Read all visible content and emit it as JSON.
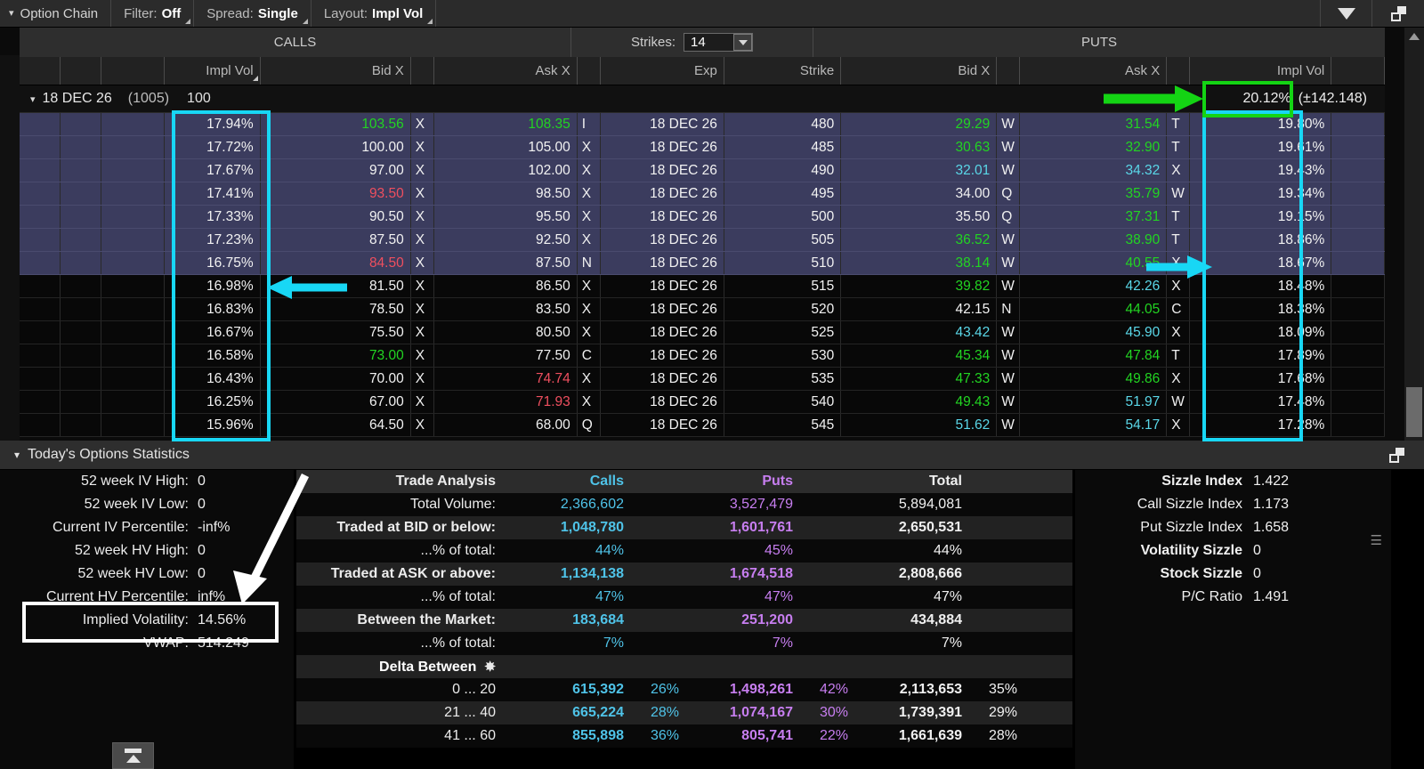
{
  "topbar": {
    "title": "Option Chain",
    "filter_label": "Filter:",
    "filter_value": "Off",
    "spread_label": "Spread:",
    "spread_value": "Single",
    "layout_label": "Layout:",
    "layout_value": "Impl Vol",
    "dropdown_icon": "triangle-down-icon",
    "popout_icon": "popout-window-icon"
  },
  "chain": {
    "calls_header": "CALLS",
    "puts_header": "PUTS",
    "strikes_label": "Strikes:",
    "strikes_value": "14",
    "columns": {
      "call_impl_vol": "Impl Vol",
      "call_bid": "Bid X",
      "call_ask": "Ask X",
      "exp": "Exp",
      "strike": "Strike",
      "put_bid": "Bid X",
      "put_ask": "Ask X",
      "put_impl_vol": "Impl Vol"
    },
    "expiry": {
      "name": "18 DEC 26",
      "days": "(1005)",
      "multiplier": "100",
      "header_iv": "20.12%",
      "header_iv_range": "(±142.148)"
    },
    "rows": [
      {
        "civ": "17.94%",
        "cbid": "103.56",
        "cbx": "X",
        "cask": "108.35",
        "cax": "I",
        "exp": "18 DEC 26",
        "strike": "480",
        "pbid": "29.29",
        "pbx": "W",
        "pask": "31.54",
        "pax": "T",
        "piv": "19.80%",
        "sel": true,
        "cbid_c": "green",
        "cbx_c": "green",
        "cask_c": "green",
        "cax_c": "green",
        "pbid_c": "green",
        "pbx_c": "green",
        "pask_c": "green",
        "pax_c": "green"
      },
      {
        "civ": "17.72%",
        "cbid": "100.00",
        "cbx": "X",
        "cask": "105.00",
        "cax": "X",
        "exp": "18 DEC 26",
        "strike": "485",
        "pbid": "30.63",
        "pbx": "W",
        "pask": "32.90",
        "pax": "T",
        "piv": "19.61%",
        "sel": true,
        "cbid_c": "white",
        "cbx_c": "white",
        "cask_c": "white",
        "cax_c": "white",
        "pbid_c": "green",
        "pbx_c": "green",
        "pask_c": "green",
        "pax_c": "green"
      },
      {
        "civ": "17.67%",
        "cbid": "97.00",
        "cbx": "X",
        "cask": "102.00",
        "cax": "X",
        "exp": "18 DEC 26",
        "strike": "490",
        "pbid": "32.01",
        "pbx": "W",
        "pask": "34.32",
        "pax": "X",
        "piv": "19.43%",
        "sel": true,
        "cbid_c": "white",
        "cbx_c": "white",
        "cask_c": "white",
        "cax_c": "white",
        "pbid_c": "cyan",
        "pbx_c": "cyan",
        "pask_c": "cyan",
        "pax_c": "cyan"
      },
      {
        "civ": "17.41%",
        "cbid": "93.50",
        "cbx": "X",
        "cask": "98.50",
        "cax": "X",
        "exp": "18 DEC 26",
        "strike": "495",
        "pbid": "34.00",
        "pbx": "Q",
        "pask": "35.79",
        "pax": "W",
        "piv": "19.34%",
        "sel": true,
        "cbid_c": "red",
        "cbx_c": "red",
        "cask_c": "white",
        "cax_c": "white",
        "pbid_c": "white",
        "pbx_c": "white",
        "pask_c": "green",
        "pax_c": "green"
      },
      {
        "civ": "17.33%",
        "cbid": "90.50",
        "cbx": "X",
        "cask": "95.50",
        "cax": "X",
        "exp": "18 DEC 26",
        "strike": "500",
        "pbid": "35.50",
        "pbx": "Q",
        "pask": "37.31",
        "pax": "T",
        "piv": "19.15%",
        "sel": true,
        "cbid_c": "white",
        "cbx_c": "white",
        "cask_c": "white",
        "cax_c": "white",
        "pbid_c": "white",
        "pbx_c": "white",
        "pask_c": "green",
        "pax_c": "green"
      },
      {
        "civ": "17.23%",
        "cbid": "87.50",
        "cbx": "X",
        "cask": "92.50",
        "cax": "X",
        "exp": "18 DEC 26",
        "strike": "505",
        "pbid": "36.52",
        "pbx": "W",
        "pask": "38.90",
        "pax": "T",
        "piv": "18.86%",
        "sel": true,
        "cbid_c": "white",
        "cbx_c": "white",
        "cask_c": "white",
        "cax_c": "white",
        "pbid_c": "green",
        "pbx_c": "green",
        "pask_c": "green",
        "pax_c": "green"
      },
      {
        "civ": "16.75%",
        "cbid": "84.50",
        "cbx": "X",
        "cask": "87.50",
        "cax": "N",
        "exp": "18 DEC 26",
        "strike": "510",
        "pbid": "38.14",
        "pbx": "W",
        "pask": "40.55",
        "pax": "X",
        "piv": "18.67%",
        "sel": true,
        "cbid_c": "red",
        "cbx_c": "red",
        "cask_c": "white",
        "cax_c": "white",
        "pbid_c": "green",
        "pbx_c": "green",
        "pask_c": "green",
        "pax_c": "green"
      },
      {
        "civ": "16.98%",
        "cbid": "81.50",
        "cbx": "X",
        "cask": "86.50",
        "cax": "X",
        "exp": "18 DEC 26",
        "strike": "515",
        "pbid": "39.82",
        "pbx": "W",
        "pask": "42.26",
        "pax": "X",
        "piv": "18.48%",
        "sel": false,
        "cbid_c": "white",
        "cbx_c": "white",
        "cask_c": "white",
        "cax_c": "white",
        "pbid_c": "green",
        "pbx_c": "green",
        "pask_c": "cyan",
        "pax_c": "cyan"
      },
      {
        "civ": "16.83%",
        "cbid": "78.50",
        "cbx": "X",
        "cask": "83.50",
        "cax": "X",
        "exp": "18 DEC 26",
        "strike": "520",
        "pbid": "42.15",
        "pbx": "N",
        "pask": "44.05",
        "pax": "C",
        "piv": "18.38%",
        "sel": false,
        "cbid_c": "white",
        "cbx_c": "white",
        "cask_c": "white",
        "cax_c": "white",
        "pbid_c": "white",
        "pbx_c": "white",
        "pask_c": "green",
        "pax_c": "green"
      },
      {
        "civ": "16.67%",
        "cbid": "75.50",
        "cbx": "X",
        "cask": "80.50",
        "cax": "X",
        "exp": "18 DEC 26",
        "strike": "525",
        "pbid": "43.42",
        "pbx": "W",
        "pask": "45.90",
        "pax": "X",
        "piv": "18.09%",
        "sel": false,
        "cbid_c": "white",
        "cbx_c": "white",
        "cask_c": "white",
        "cax_c": "white",
        "pbid_c": "cyan",
        "pbx_c": "cyan",
        "pask_c": "cyan",
        "pax_c": "cyan"
      },
      {
        "civ": "16.58%",
        "cbid": "73.00",
        "cbx": "X",
        "cask": "77.50",
        "cax": "C",
        "exp": "18 DEC 26",
        "strike": "530",
        "pbid": "45.34",
        "pbx": "W",
        "pask": "47.84",
        "pax": "T",
        "piv": "17.89%",
        "sel": false,
        "cbid_c": "green",
        "cbx_c": "green",
        "cask_c": "white",
        "cax_c": "white",
        "pbid_c": "green",
        "pbx_c": "green",
        "pask_c": "green",
        "pax_c": "green"
      },
      {
        "civ": "16.43%",
        "cbid": "70.00",
        "cbx": "X",
        "cask": "74.74",
        "cax": "X",
        "exp": "18 DEC 26",
        "strike": "535",
        "pbid": "47.33",
        "pbx": "W",
        "pask": "49.86",
        "pax": "X",
        "piv": "17.68%",
        "sel": false,
        "cbid_c": "white",
        "cbx_c": "white",
        "cask_c": "red",
        "cax_c": "red",
        "pbid_c": "green",
        "pbx_c": "green",
        "pask_c": "green",
        "pax_c": "green"
      },
      {
        "civ": "16.25%",
        "cbid": "67.00",
        "cbx": "X",
        "cask": "71.93",
        "cax": "X",
        "exp": "18 DEC 26",
        "strike": "540",
        "pbid": "49.43",
        "pbx": "W",
        "pask": "51.97",
        "pax": "W",
        "piv": "17.48%",
        "sel": false,
        "cbid_c": "white",
        "cbx_c": "white",
        "cask_c": "red",
        "cax_c": "red",
        "pbid_c": "green",
        "pbx_c": "green",
        "pask_c": "cyan",
        "pax_c": "cyan"
      },
      {
        "civ": "15.96%",
        "cbid": "64.50",
        "cbx": "X",
        "cask": "68.00",
        "cax": "Q",
        "exp": "18 DEC 26",
        "strike": "545",
        "pbid": "51.62",
        "pbx": "W",
        "pask": "54.17",
        "pax": "X",
        "piv": "17.28%",
        "sel": false,
        "cbid_c": "white",
        "cbx_c": "white",
        "cask_c": "white",
        "cax_c": "white",
        "pbid_c": "cyan",
        "pbx_c": "cyan",
        "pask_c": "cyan",
        "pax_c": "cyan"
      }
    ]
  },
  "stats": {
    "title": "Today's Options Statistics",
    "left_rows": [
      {
        "label": "52 week IV High:",
        "value": "0"
      },
      {
        "label": "52 week IV Low:",
        "value": "0"
      },
      {
        "label": "Current IV Percentile:",
        "value": "-inf%"
      },
      {
        "label": "52 week HV High:",
        "value": "0"
      },
      {
        "label": "52 week HV Low:",
        "value": "0"
      },
      {
        "label": "Current HV Percentile:",
        "value": "inf%"
      },
      {
        "label": "Implied Volatility:",
        "value": "14.56%"
      },
      {
        "label": "VWAP:",
        "value": "514.249"
      }
    ],
    "trade_analysis": {
      "title": "Trade Analysis",
      "col_calls": "Calls",
      "col_puts": "Puts",
      "col_total": "Total",
      "rows": [
        {
          "label": "Total Volume:",
          "bold": false,
          "calls": "2,366,602",
          "puts": "3,527,479",
          "total": "5,894,081"
        },
        {
          "label": "Traded at BID or below:",
          "bold": true,
          "calls": "1,048,780",
          "puts": "1,601,761",
          "total": "2,650,531"
        },
        {
          "label": "...% of total:",
          "bold": false,
          "calls": "44%",
          "puts": "45%",
          "total": "44%"
        },
        {
          "label": "Traded at ASK or above:",
          "bold": true,
          "calls": "1,134,138",
          "puts": "1,674,518",
          "total": "2,808,666"
        },
        {
          "label": "...% of total:",
          "bold": false,
          "calls": "47%",
          "puts": "47%",
          "total": "47%"
        },
        {
          "label": "Between the Market:",
          "bold": true,
          "calls": "183,684",
          "puts": "251,200",
          "total": "434,884"
        },
        {
          "label": "...% of total:",
          "bold": false,
          "calls": "7%",
          "puts": "7%",
          "total": "7%"
        }
      ],
      "delta_header": "Delta Between",
      "delta_gear_icon": "gear-icon",
      "delta_rows": [
        {
          "range": "0 ... 20",
          "calls": "615,392",
          "calls_pct": "26%",
          "puts": "1,498,261",
          "puts_pct": "42%",
          "total": "2,113,653",
          "total_pct": "35%"
        },
        {
          "range": "21 ... 40",
          "calls": "665,224",
          "calls_pct": "28%",
          "puts": "1,074,167",
          "puts_pct": "30%",
          "total": "1,739,391",
          "total_pct": "29%"
        },
        {
          "range": "41 ... 60",
          "calls": "855,898",
          "calls_pct": "36%",
          "puts": "805,741",
          "puts_pct": "22%",
          "total": "1,661,639",
          "total_pct": "28%"
        }
      ]
    },
    "sizzle": [
      {
        "label": "Sizzle Index",
        "value": "1.422",
        "bold": true
      },
      {
        "label": "Call Sizzle Index",
        "value": "1.173",
        "bold": false
      },
      {
        "label": "Put Sizzle Index",
        "value": "1.658",
        "bold": false
      },
      {
        "label": "Volatility Sizzle",
        "value": "0",
        "bold": true
      },
      {
        "label": "Stock Sizzle",
        "value": "0",
        "bold": true
      },
      {
        "label": "P/C Ratio",
        "value": "1.491",
        "bold": false
      }
    ]
  },
  "annotations": {
    "cyan_color": "#18d7f5",
    "green_color": "#14d414",
    "white_color": "#ffffff"
  }
}
